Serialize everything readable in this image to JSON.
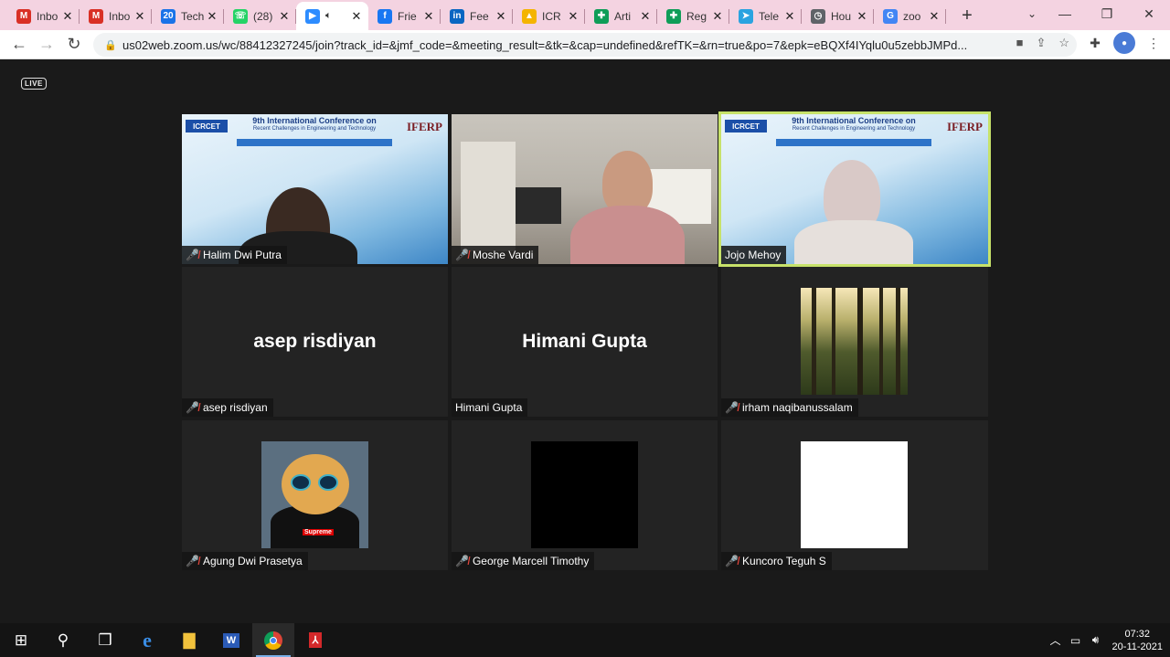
{
  "browser": {
    "tabs": [
      {
        "title": "Inbo",
        "favicon": "gmail-icon",
        "color": "#d93025"
      },
      {
        "title": "Inbo",
        "favicon": "gmail-icon",
        "color": "#d93025"
      },
      {
        "title": "Tech",
        "favicon": "calendar-icon",
        "color": "#1a73e8"
      },
      {
        "title": "(28)",
        "favicon": "whatsapp-icon",
        "color": "#25d366"
      },
      {
        "title": "",
        "favicon": "zoom-icon",
        "color": "#2d8cff",
        "active": true
      },
      {
        "title": "Frie",
        "favicon": "facebook-icon",
        "color": "#1877f2"
      },
      {
        "title": "Fee",
        "favicon": "linkedin-icon",
        "color": "#0a66c2"
      },
      {
        "title": "ICR",
        "favicon": "google-drive-icon",
        "color": "#f4b400"
      },
      {
        "title": "Arti",
        "favicon": "google-sheets-icon",
        "color": "#0f9d58"
      },
      {
        "title": "Reg",
        "favicon": "google-sheets-icon",
        "color": "#0f9d58"
      },
      {
        "title": "Tele",
        "favicon": "telegram-icon",
        "color": "#2aa3e0"
      },
      {
        "title": "Hou",
        "favicon": "clock-icon",
        "color": "#5f6368"
      },
      {
        "title": "zoo",
        "favicon": "google-icon",
        "color": "#4285f4"
      }
    ],
    "url": "us02web.zoom.us/wc/88412327245/join?track_id=&jmf_code=&meeting_result=&tk=&cap=undefined&refTK=&rn=true&po=7&epk=eBQXf4IYqlu0u5zebbJMPd..."
  },
  "meeting": {
    "live_badge": "LIVE",
    "participants": [
      {
        "name": "Halim Dwi Putra",
        "muted": true,
        "video": "banner"
      },
      {
        "name": "Moshe Vardi",
        "muted": true,
        "video": "camera"
      },
      {
        "name": "Jojo Mehoy",
        "muted": false,
        "video": "banner",
        "speaking": true
      },
      {
        "name": "asep risdiyan",
        "muted": true,
        "video": "off",
        "display": "asep risdiyan"
      },
      {
        "name": "Himani Gupta",
        "muted": false,
        "video": "off",
        "display": "Himani Gupta"
      },
      {
        "name": "irham naqibanussalam",
        "muted": true,
        "video": "avatar-forest"
      },
      {
        "name": "Agung Dwi Prasetya",
        "muted": true,
        "video": "avatar-cat"
      },
      {
        "name": "George Marcell Timothy",
        "muted": true,
        "video": "avatar-black"
      },
      {
        "name": "Kuncoro Teguh S",
        "muted": true,
        "video": "avatar-white"
      }
    ],
    "banner": {
      "logo": "ICRCET",
      "title": "9th International Conference on",
      "subtitle": "Recent Challenges in Engineering and Technology",
      "org": "IFERP"
    },
    "cat_label": "Supreme"
  },
  "taskbar": {
    "time": "07:32",
    "date": "20-11-2021"
  },
  "colors": {
    "speaking_outline": "#c7e26a",
    "muted_mic": "#e0453c",
    "tab_strip": "#f4d3e1"
  }
}
